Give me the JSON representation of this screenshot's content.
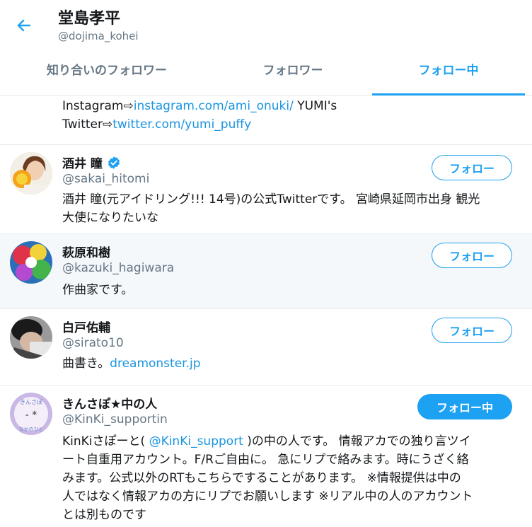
{
  "header": {
    "name": "堂島孝平",
    "handle": "@dojima_kohei"
  },
  "tabs": [
    {
      "label": "知り合いのフォロワー"
    },
    {
      "label": "フォロワー"
    },
    {
      "label": "フォロー中"
    }
  ],
  "partial": {
    "line1_prefix": "Instagram⇨",
    "line1_link": "instagram.com/ami_onuki/",
    "line1_suffix": " YUMI's",
    "line2_prefix": "Twitter⇨",
    "line2_link": "twitter.com/yumi_puffy"
  },
  "users": [
    {
      "name": "酒井 瞳",
      "handle": "@sakai_hitomi",
      "verified": true,
      "bio_line1": "酒井 瞳(元アイドリング!!! 14号)の公式Twitterです。 宮崎県延岡市出身 観光",
      "bio_line2": "大使になりたいな",
      "button": "フォロー"
    },
    {
      "name": "萩原和樹",
      "handle": "@kazuki_hagiwara",
      "bio_line1": "作曲家です。",
      "button": "フォロー"
    },
    {
      "name": "白戸佑輔",
      "handle": "@sirato10",
      "bio_prefix": "曲書き。",
      "bio_link": "dreamonster.jp",
      "button": "フォロー"
    },
    {
      "name": "きんさぽ★中の人",
      "handle": "@KinKi_supportin",
      "bio_l1_prefix": "KinKiさぽーと( ",
      "bio_l1_link": "@KinKi_support",
      "bio_l1_suffix": " )の中の人です。 情報アカでの独り言ツイ",
      "bio_l2": "ート自重用アカウント。F/Rご自由に。 急にリプで絡みます。時にうざく絡",
      "bio_l3": "みます。公式以外のRTもこちらですることがあります。 ※情報提供は中の",
      "bio_l4": "人ではなく情報アカの方にリプでお願いします ※リアル中の人のアカウント",
      "bio_l5": "とは別ものです",
      "button": "フォロー中",
      "avatar_text_top": "きんさぽ",
      "avatar_text_bottom": "なかのひと"
    }
  ],
  "colors": {
    "accent": "#1da1f2",
    "link": "#1b95e0",
    "muted": "#657786"
  },
  "icons": {
    "back": "arrow-left-icon",
    "verified": "verified-badge-icon"
  }
}
